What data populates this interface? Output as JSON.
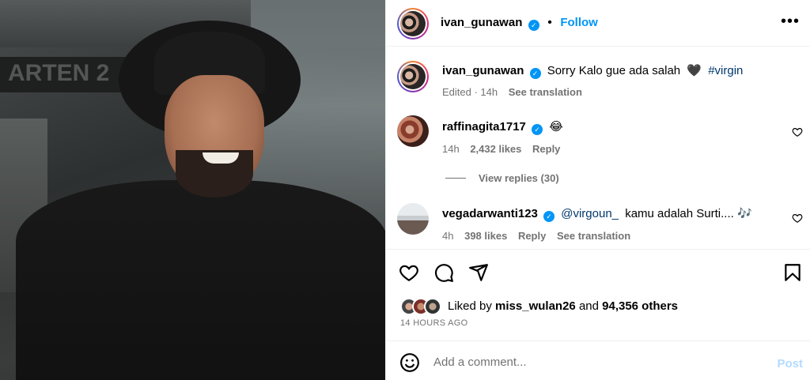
{
  "post": {
    "author": "ivan_gunawan",
    "follow_label": "Follow",
    "dot": "•",
    "more_label": "•••",
    "caption_author": "ivan_gunawan",
    "caption_text": "Sorry Kalo gue ada salah",
    "caption_emoji": "🖤",
    "caption_hashtag": "#virgin",
    "caption_meta_edited": "Edited · 14h",
    "caption_meta_translate": "See translation",
    "photo_sign_text": "ARTEN 2"
  },
  "comments": [
    {
      "username": "raffinagita1717",
      "text": "😂",
      "time": "14h",
      "likes": "2,432 likes",
      "reply_label": "Reply",
      "view_replies": "View replies (30)"
    },
    {
      "username": "vegadarwanti123",
      "mention": "@virgoun_",
      "text": "kamu adalah Surti.... 🎶",
      "time": "4h",
      "likes": "398 likes",
      "reply_label": "Reply",
      "translate_label": "See translation"
    }
  ],
  "likes_summary": {
    "prefix": "Liked by",
    "user": "miss_wulan26",
    "connector": "and",
    "others": "94,356 others"
  },
  "timestamp": "14 HOURS AGO",
  "comment_box": {
    "placeholder": "Add a comment...",
    "post_label": "Post"
  },
  "colors": {
    "accent": "#0095f6",
    "muted": "#737373",
    "post_disabled": "#b3dbff"
  },
  "icons": [
    "heart-icon",
    "comment-icon",
    "share-icon",
    "bookmark-icon",
    "emoji-icon",
    "verified-icon",
    "more-icon"
  ]
}
